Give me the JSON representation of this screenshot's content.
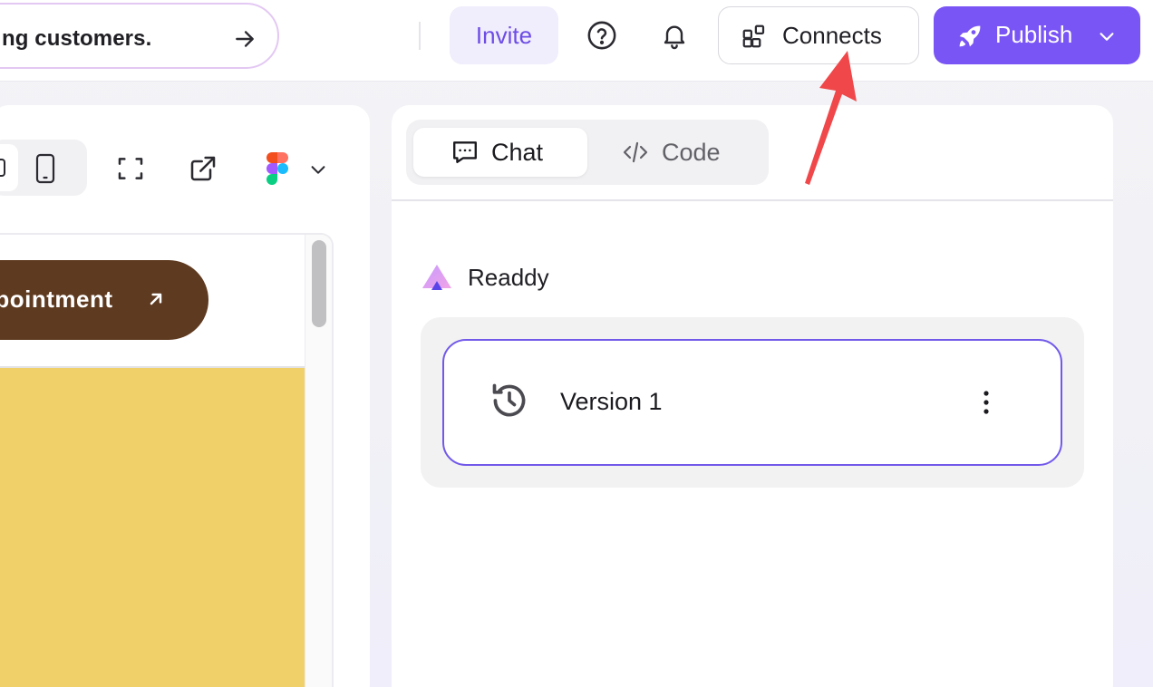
{
  "topbar": {
    "prompt_text": "ng customers.",
    "invite_label": "Invite",
    "connects_label": "Connects",
    "publish_label": "Publish"
  },
  "preview": {
    "appointment_label": "ppointment"
  },
  "chat_panel": {
    "tabs": [
      {
        "label": "Chat",
        "active": true
      },
      {
        "label": "Code",
        "active": false
      }
    ],
    "assistant_name": "Readdy",
    "versions": [
      {
        "label": "Version 1"
      }
    ]
  },
  "colors": {
    "accent": "#7a55f5",
    "invite_bg": "#f0edfc",
    "appointment_bg": "#5e3a20",
    "preview_hero_bg": "#f0d068",
    "annotation_arrow": "#f0484a"
  },
  "icons": [
    "arrow-right-icon",
    "help-circle-icon",
    "bell-icon",
    "connects-grid-icon",
    "rocket-icon",
    "chevron-down-icon",
    "mobile-icon",
    "fullscreen-icon",
    "external-link-icon",
    "figma-icon",
    "chat-bubble-icon",
    "code-icon",
    "readdy-logo-icon",
    "history-icon",
    "more-vertical-icon",
    "arrow-up-right-icon"
  ]
}
